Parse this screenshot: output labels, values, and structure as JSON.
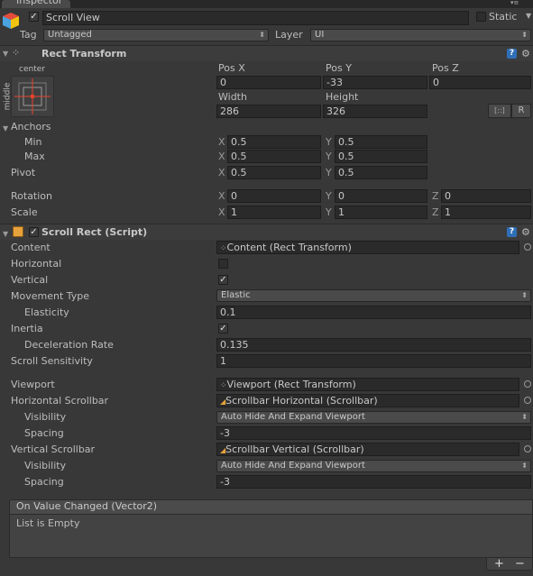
{
  "window": {
    "tab_title": "Inspector"
  },
  "object": {
    "name": "Scroll View",
    "active": true,
    "static_label": "Static",
    "tag_label": "Tag",
    "tag_value": "Untagged",
    "layer_label": "Layer",
    "layer_value": "UI"
  },
  "rect_transform": {
    "title": "Rect Transform",
    "anchor_h": "center",
    "anchor_v": "middle",
    "pos_x_label": "Pos X",
    "pos_y_label": "Pos Y",
    "pos_z_label": "Pos Z",
    "pos_x": "0",
    "pos_y": "-33",
    "pos_z": "0",
    "width_label": "Width",
    "height_label": "Height",
    "width": "286",
    "height": "326",
    "r_button": "R",
    "anchors_label": "Anchors",
    "min_label": "Min",
    "max_label": "Max",
    "min_x": "0.5",
    "min_y": "0.5",
    "max_x": "0.5",
    "max_y": "0.5",
    "pivot_label": "Pivot",
    "pivot_x": "0.5",
    "pivot_y": "0.5",
    "rotation_label": "Rotation",
    "rot_x": "0",
    "rot_y": "0",
    "rot_z": "0",
    "scale_label": "Scale",
    "scale_x": "1",
    "scale_y": "1",
    "scale_z": "1",
    "x": "X",
    "y": "Y",
    "z": "Z"
  },
  "scroll_rect": {
    "title": "Scroll Rect (Script)",
    "enabled": true,
    "content_label": "Content",
    "content_value": "Content (Rect Transform)",
    "horizontal_label": "Horizontal",
    "horizontal": false,
    "vertical_label": "Vertical",
    "vertical": true,
    "movement_type_label": "Movement Type",
    "movement_type": "Elastic",
    "elasticity_label": "Elasticity",
    "elasticity": "0.1",
    "inertia_label": "Inertia",
    "inertia": true,
    "deceleration_label": "Deceleration Rate",
    "deceleration": "0.135",
    "sensitivity_label": "Scroll Sensitivity",
    "sensitivity": "1",
    "viewport_label": "Viewport",
    "viewport_value": "Viewport (Rect Transform)",
    "hscroll_label": "Horizontal Scrollbar",
    "hscroll_value": "Scrollbar Horizontal (Scrollbar)",
    "visibility_label": "Visibility",
    "h_visibility": "Auto Hide And Expand Viewport",
    "spacing_label": "Spacing",
    "h_spacing": "-3",
    "vscroll_label": "Vertical Scrollbar",
    "vscroll_value": "Scrollbar Vertical (Scrollbar)",
    "v_visibility": "Auto Hide And Expand Viewport",
    "v_spacing": "-3"
  },
  "event": {
    "title": "On Value Changed (Vector2)",
    "empty_text": "List is Empty",
    "add": "+",
    "remove": "−"
  },
  "colors": {
    "background": "#383838",
    "field": "#2a2a2a",
    "header": "#3c3c3c",
    "text": "#bdbdbd",
    "anchor_red": "#e8442c"
  }
}
